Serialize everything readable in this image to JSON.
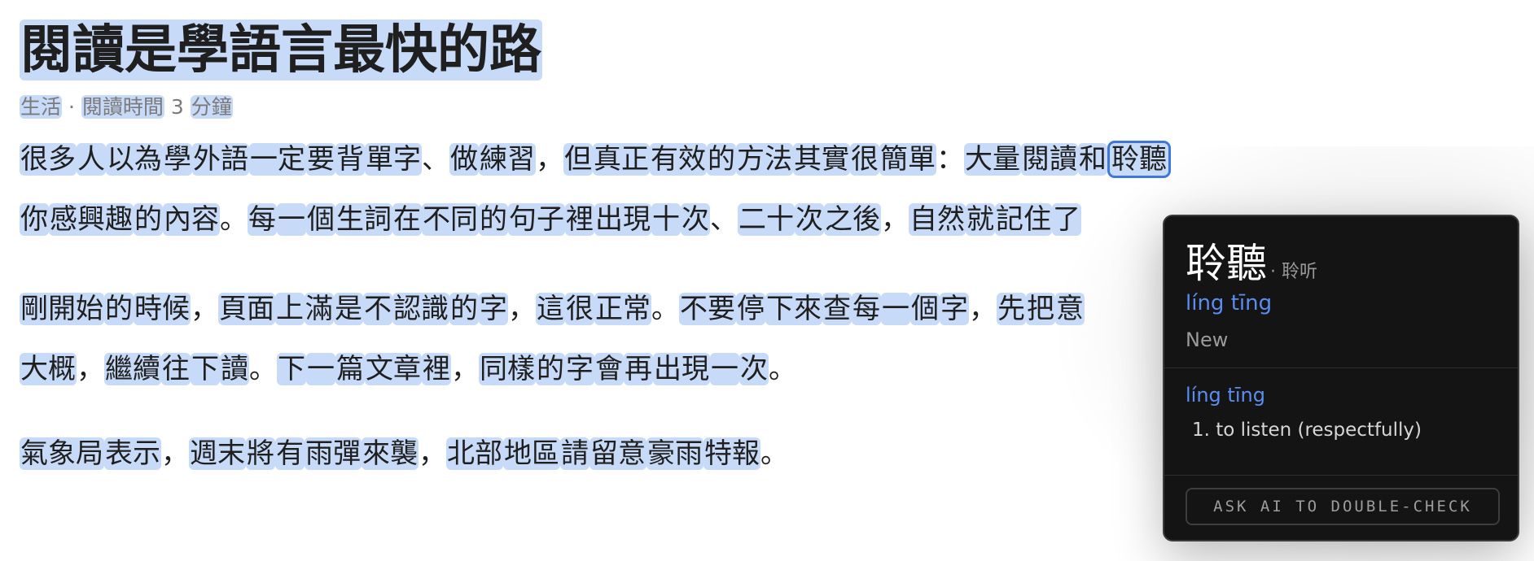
{
  "article": {
    "title": "閱讀是學語言最快的路",
    "meta": {
      "category": "生活",
      "separator": " · ",
      "reading_time_label": "閱讀時間",
      "reading_time_value": " 3 ",
      "reading_time_unit": "分鐘"
    },
    "paragraphs": [
      {
        "lines": [
          [
            {
              "t": "很多",
              "w": true
            },
            {
              "t": "人",
              "w": true
            },
            {
              "t": "以為",
              "w": true
            },
            {
              "t": "學",
              "w": true
            },
            {
              "t": "外語",
              "w": true
            },
            {
              "t": "一定",
              "w": true
            },
            {
              "t": "要",
              "w": true
            },
            {
              "t": "背",
              "w": true
            },
            {
              "t": "單字",
              "w": true
            },
            {
              "t": "、",
              "w": false
            },
            {
              "t": "做",
              "w": true
            },
            {
              "t": "練習",
              "w": true
            },
            {
              "t": "，",
              "w": false
            },
            {
              "t": "但",
              "w": true
            },
            {
              "t": "真正",
              "w": true
            },
            {
              "t": "有效",
              "w": true
            },
            {
              "t": "的",
              "w": true
            },
            {
              "t": "方法",
              "w": true
            },
            {
              "t": "其實",
              "w": true
            },
            {
              "t": "很",
              "w": true
            },
            {
              "t": "簡單",
              "w": true
            },
            {
              "t": "：",
              "w": false
            },
            {
              "t": "大量",
              "w": true
            },
            {
              "t": "閱讀",
              "w": true
            },
            {
              "t": "和",
              "w": true
            },
            {
              "t": "聆聽",
              "w": true,
              "selected": true
            }
          ],
          [
            {
              "t": "你",
              "w": true
            },
            {
              "t": "感興趣",
              "w": true
            },
            {
              "t": "的",
              "w": true
            },
            {
              "t": "內容",
              "w": true
            },
            {
              "t": "。",
              "w": false
            },
            {
              "t": "每",
              "w": true
            },
            {
              "t": "一",
              "w": true
            },
            {
              "t": "個",
              "w": true
            },
            {
              "t": "生詞",
              "w": true
            },
            {
              "t": "在",
              "w": true
            },
            {
              "t": "不同",
              "w": true
            },
            {
              "t": "的",
              "w": true
            },
            {
              "t": "句子",
              "w": true
            },
            {
              "t": "裡",
              "w": true
            },
            {
              "t": "出現",
              "w": true
            },
            {
              "t": "十",
              "w": true
            },
            {
              "t": "次",
              "w": true
            },
            {
              "t": "、",
              "w": false
            },
            {
              "t": "二十",
              "w": true
            },
            {
              "t": "次",
              "w": true
            },
            {
              "t": "之後",
              "w": true
            },
            {
              "t": "，",
              "w": false
            },
            {
              "t": "自然",
              "w": true
            },
            {
              "t": "就",
              "w": true
            },
            {
              "t": "記住",
              "w": true
            },
            {
              "t": "了",
              "w": true
            }
          ]
        ]
      },
      {
        "lines": [
          [
            {
              "t": "剛開始",
              "w": true
            },
            {
              "t": "的",
              "w": true
            },
            {
              "t": "時候",
              "w": true
            },
            {
              "t": "，",
              "w": false
            },
            {
              "t": "頁面",
              "w": true
            },
            {
              "t": "上",
              "w": true
            },
            {
              "t": "滿",
              "w": true
            },
            {
              "t": "是",
              "w": true
            },
            {
              "t": "不",
              "w": true
            },
            {
              "t": "認識",
              "w": true
            },
            {
              "t": "的",
              "w": true
            },
            {
              "t": "字",
              "w": true
            },
            {
              "t": "，",
              "w": false
            },
            {
              "t": "這",
              "w": true
            },
            {
              "t": "很",
              "w": true
            },
            {
              "t": "正常",
              "w": true
            },
            {
              "t": "。",
              "w": false
            },
            {
              "t": "不要",
              "w": true
            },
            {
              "t": "停",
              "w": true
            },
            {
              "t": "下來",
              "w": true
            },
            {
              "t": "查",
              "w": true
            },
            {
              "t": "每",
              "w": true
            },
            {
              "t": "一",
              "w": true
            },
            {
              "t": "個",
              "w": true
            },
            {
              "t": "字",
              "w": true
            },
            {
              "t": "，",
              "w": false
            },
            {
              "t": "先",
              "w": true
            },
            {
              "t": "把",
              "w": true
            },
            {
              "t": "意",
              "w": true
            }
          ],
          [
            {
              "t": "大概",
              "w": true
            },
            {
              "t": "，",
              "w": false
            },
            {
              "t": "繼續",
              "w": true
            },
            {
              "t": "往",
              "w": true
            },
            {
              "t": "下",
              "w": true
            },
            {
              "t": "讀",
              "w": true
            },
            {
              "t": "。",
              "w": false
            },
            {
              "t": "下",
              "w": true
            },
            {
              "t": "一",
              "w": true
            },
            {
              "t": "篇",
              "w": true
            },
            {
              "t": "文章",
              "w": true
            },
            {
              "t": "裡",
              "w": true
            },
            {
              "t": "，",
              "w": false
            },
            {
              "t": "同樣",
              "w": true
            },
            {
              "t": "的",
              "w": true
            },
            {
              "t": "字",
              "w": true
            },
            {
              "t": "會",
              "w": true
            },
            {
              "t": "再",
              "w": true
            },
            {
              "t": "出現",
              "w": true
            },
            {
              "t": "一",
              "w": true
            },
            {
              "t": "次",
              "w": true
            },
            {
              "t": "。",
              "w": false
            }
          ]
        ]
      },
      {
        "lines": [
          [
            {
              "t": "氣象局",
              "w": true
            },
            {
              "t": "表示",
              "w": true
            },
            {
              "t": "，",
              "w": false
            },
            {
              "t": "週末",
              "w": true
            },
            {
              "t": "將",
              "w": true
            },
            {
              "t": "有",
              "w": true
            },
            {
              "t": "雨彈",
              "w": true
            },
            {
              "t": "來襲",
              "w": true
            },
            {
              "t": "，",
              "w": false
            },
            {
              "t": "北部",
              "w": true
            },
            {
              "t": "地區",
              "w": true
            },
            {
              "t": "請",
              "w": true
            },
            {
              "t": "留意",
              "w": true
            },
            {
              "t": "豪雨",
              "w": true
            },
            {
              "t": "特報",
              "w": true
            },
            {
              "t": "。",
              "w": false
            }
          ]
        ]
      }
    ]
  },
  "popup": {
    "word": "聆聽",
    "simplified": "· 聆听",
    "pinyin": "líng tīng",
    "status": "New",
    "definition_pinyin": "líng tīng",
    "definitions": [
      "1. to listen (respectfully)"
    ],
    "ask_ai_label": "ASK AI TO DOUBLE-CHECK"
  },
  "colors": {
    "word_highlight": "#c7daf7",
    "selected_outline": "#3f78d9",
    "popup_background": "#141414",
    "pinyin_blue": "#5b8df0"
  }
}
